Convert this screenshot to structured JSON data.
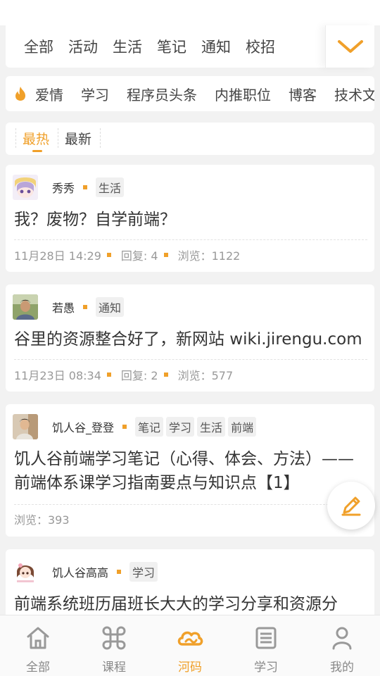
{
  "colors": {
    "accent": "#f0a02a",
    "text": "#333333",
    "muted": "#999999",
    "background": "#f2f2f2"
  },
  "categories": [
    "全部",
    "活动",
    "生活",
    "笔记",
    "通知",
    "校招"
  ],
  "tags": [
    "爱情",
    "学习",
    "程序员头条",
    "内推职位",
    "博客",
    "技术文"
  ],
  "sort": {
    "hot": "最热",
    "new": "最新"
  },
  "posts": [
    {
      "author": "秀秀",
      "tags": [
        "生活"
      ],
      "title": "我？废物？自学前端？",
      "date": "11月28日 14:29",
      "replies": "回复: 4",
      "views": "浏览：1122"
    },
    {
      "author": "若愚",
      "tags": [
        "通知"
      ],
      "title": "谷里的资源整合好了，新网站 wiki.jirengu.com",
      "date": "11月23日 08:34",
      "replies": "回复: 2",
      "views": "浏览：577"
    },
    {
      "author": "饥人谷_登登",
      "tags": [
        "笔记",
        "学习",
        "生活",
        "前端"
      ],
      "title": "饥人谷前端学习笔记（心得、体会、方法）——前端体系课学习指南要点与知识点【1】",
      "views": "浏览：393"
    },
    {
      "author": "饥人谷高高",
      "tags": [
        "学习"
      ],
      "title": "前端系统班历届班长大大的学习分享和资源分"
    }
  ],
  "nav": [
    {
      "label": "全部",
      "icon": "home-icon"
    },
    {
      "label": "课程",
      "icon": "command-icon"
    },
    {
      "label": "河码",
      "icon": "cloud-icon"
    },
    {
      "label": "学习",
      "icon": "list-icon"
    },
    {
      "label": "我的",
      "icon": "person-icon"
    }
  ],
  "nav_active": 2
}
